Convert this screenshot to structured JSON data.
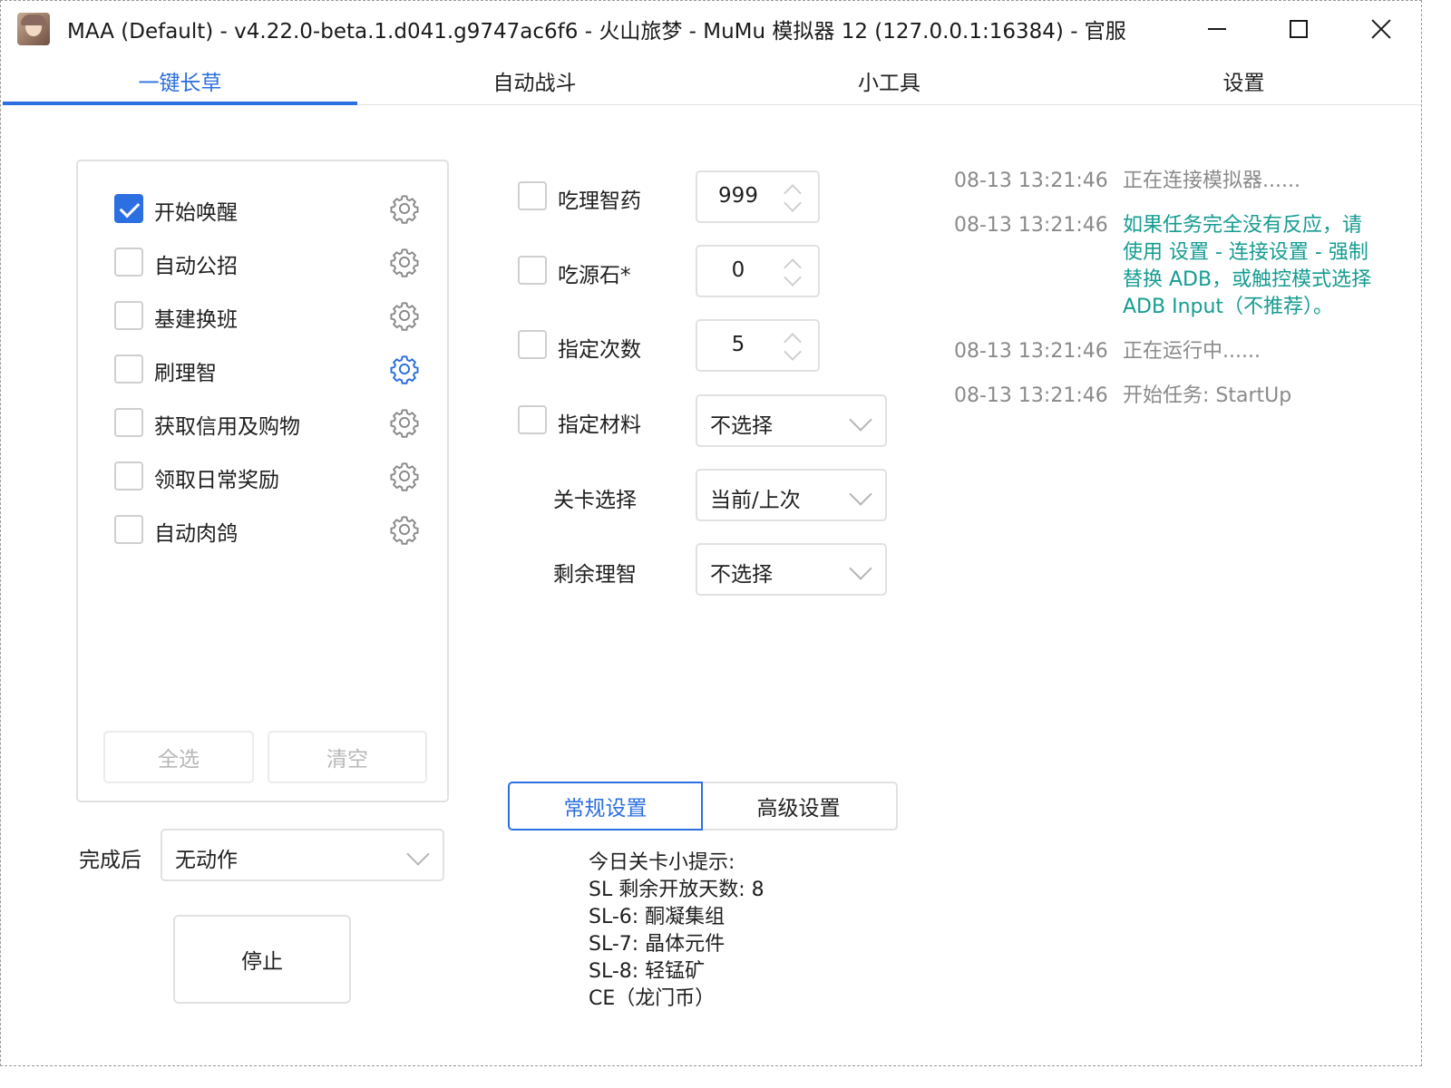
{
  "window": {
    "title": "MAA (Default) - v4.22.0-beta.1.d041.g9747ac6f6 - 火山旅梦 - MuMu 模拟器 12 (127.0.0.1:16384) - 官服"
  },
  "tabs": [
    {
      "label": "一键长草",
      "active": true
    },
    {
      "label": "自动战斗",
      "active": false
    },
    {
      "label": "小工具",
      "active": false
    },
    {
      "label": "设置",
      "active": false
    }
  ],
  "tasks": [
    {
      "label": "开始唤醒",
      "checked": true,
      "gear_color": "#8a8a8a"
    },
    {
      "label": "自动公招",
      "checked": false,
      "gear_color": "#8a8a8a"
    },
    {
      "label": "基建换班",
      "checked": false,
      "gear_color": "#8a8a8a"
    },
    {
      "label": "刷理智",
      "checked": false,
      "gear_color": "#2c6fe0"
    },
    {
      "label": "获取信用及购物",
      "checked": false,
      "gear_color": "#8a8a8a"
    },
    {
      "label": "领取日常奖励",
      "checked": false,
      "gear_color": "#8a8a8a"
    },
    {
      "label": "自动肉鸽",
      "checked": false,
      "gear_color": "#8a8a8a"
    }
  ],
  "task_buttons": {
    "select_all": "全选",
    "clear": "清空"
  },
  "after": {
    "label": "完成后",
    "value": "无动作"
  },
  "stop_button": "停止",
  "options": [
    {
      "label": "吃理智药",
      "checked": false,
      "value": "999"
    },
    {
      "label": "吃源石*",
      "checked": false,
      "value": "0"
    },
    {
      "label": "指定次数",
      "checked": false,
      "value": "5"
    },
    {
      "label": "指定材料",
      "checked": false,
      "value": "不选择"
    }
  ],
  "stage": {
    "label": "关卡选择",
    "value": "当前/上次"
  },
  "remaining": {
    "label": "剩余理智",
    "value": "不选择"
  },
  "setting_tabs": {
    "normal": "常规设置",
    "advanced": "高级设置"
  },
  "tips": [
    "今日关卡小提示:",
    "SL 剩余开放天数: 8",
    "SL-6: 酮凝集组",
    "SL-7: 晶体元件",
    "SL-8: 轻锰矿",
    "CE（龙门币）"
  ],
  "log": [
    {
      "time": "08-13  13:21:46",
      "msg": "正在连接模拟器......",
      "kind": "normal"
    },
    {
      "time": "08-13  13:21:46",
      "msg": "如果任务完全没有反应，请使用 设置 - 连接设置 - 强制替换 ADB，或触控模式选择 ADB Input（不推荐）。",
      "kind": "info"
    },
    {
      "time": "08-13  13:21:46",
      "msg": "正在运行中......",
      "kind": "normal"
    },
    {
      "time": "08-13  13:21:46",
      "msg": "开始任务: StartUp",
      "kind": "normal"
    }
  ],
  "colors": {
    "accent": "#2c6fe0",
    "log_info": "#169c91",
    "log_normal": "#8a8a8a"
  }
}
